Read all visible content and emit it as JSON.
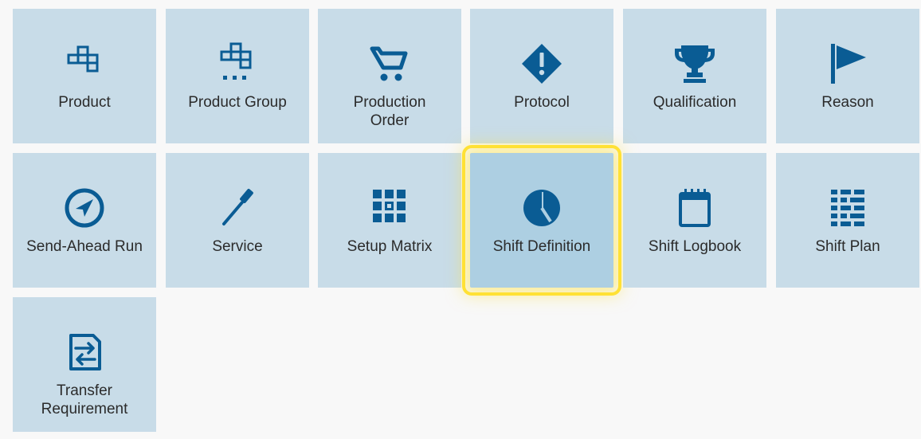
{
  "tiles": [
    {
      "label": "Product",
      "icon": "product-icon"
    },
    {
      "label": "Product Group",
      "icon": "product-group-icon"
    },
    {
      "label": "Production\nOrder",
      "icon": "shopping-cart-icon"
    },
    {
      "label": "Protocol",
      "icon": "warning-diamond-icon"
    },
    {
      "label": "Qualification",
      "icon": "trophy-icon"
    },
    {
      "label": "Reason",
      "icon": "flag-icon"
    },
    {
      "label": "Send-Ahead Run",
      "icon": "compass-icon"
    },
    {
      "label": "Service",
      "icon": "screwdriver-icon"
    },
    {
      "label": "Setup Matrix",
      "icon": "grid-matrix-icon"
    },
    {
      "label": "Shift Definition",
      "icon": "clock-pie-icon",
      "selected": true
    },
    {
      "label": "Shift Logbook",
      "icon": "notebook-icon"
    },
    {
      "label": "Shift Plan",
      "icon": "shift-plan-grid-icon"
    },
    {
      "label": "Transfer\nRequirement",
      "icon": "transfer-document-icon"
    }
  ],
  "colors": {
    "tile_background": "#c8dce8",
    "tile_selected_background": "#adcfe2",
    "icon": "#0a5c94",
    "highlight": "#ffe135"
  }
}
